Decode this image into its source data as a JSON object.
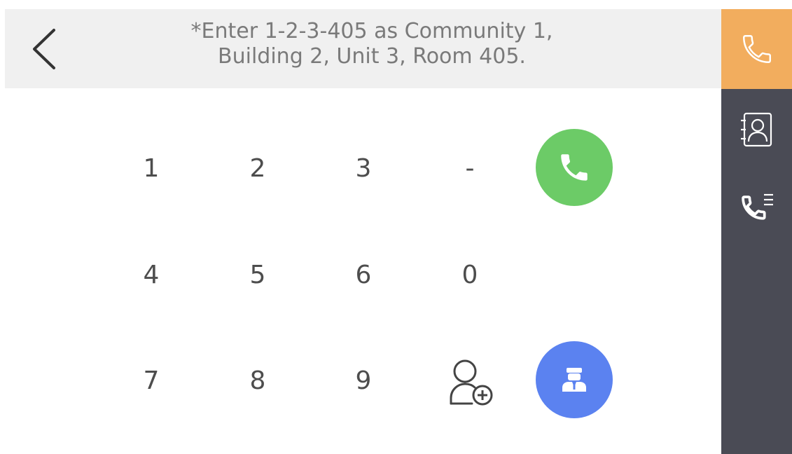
{
  "header": {
    "hint_line1": "*Enter 1-2-3-405 as Community 1,",
    "hint_line2": "Building 2, Unit 3, Room 405.",
    "back_icon": "chevron-left-icon"
  },
  "keypad": {
    "keys": [
      "1",
      "2",
      "3",
      "-",
      "4",
      "5",
      "6",
      "0",
      "7",
      "8",
      "9"
    ],
    "call_button_icon": "phone-icon",
    "call_button_color": "#6ccb67",
    "management_button_icon": "security-guard-icon",
    "management_button_color": "#5b82f0",
    "add_contact_icon": "add-user-icon"
  },
  "sidebar": {
    "background": "#4a4b55",
    "active_color": "#f2ad5e",
    "tabs": [
      {
        "icon": "phone-icon",
        "active": true
      },
      {
        "icon": "contacts-icon",
        "active": false
      },
      {
        "icon": "call-log-icon",
        "active": false
      }
    ]
  }
}
